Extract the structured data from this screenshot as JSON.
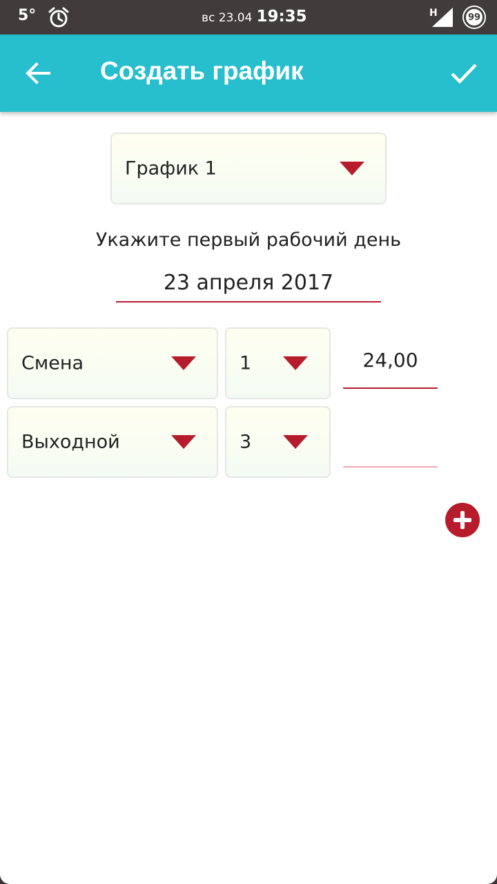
{
  "status_bar": {
    "temperature": "5°",
    "date": "вс 23.04",
    "time": "19:35",
    "network": "H",
    "battery": "99"
  },
  "app_bar": {
    "title": "Создать график",
    "back_icon": "arrow-left-icon",
    "confirm_icon": "check-icon"
  },
  "schedule_select": {
    "value": "График 1"
  },
  "first_day": {
    "label": "Укажите первый рабочий день",
    "value": "23 апреля 2017"
  },
  "rows": [
    {
      "type": "Смена",
      "count": "1",
      "hours": "24,00"
    },
    {
      "type": "Выходной",
      "count": "3",
      "hours": ""
    }
  ],
  "add_button_icon": "plus-icon",
  "colors": {
    "accent": "#27becd",
    "primary": "#b71c2c",
    "status_bar": "#403c3b"
  }
}
